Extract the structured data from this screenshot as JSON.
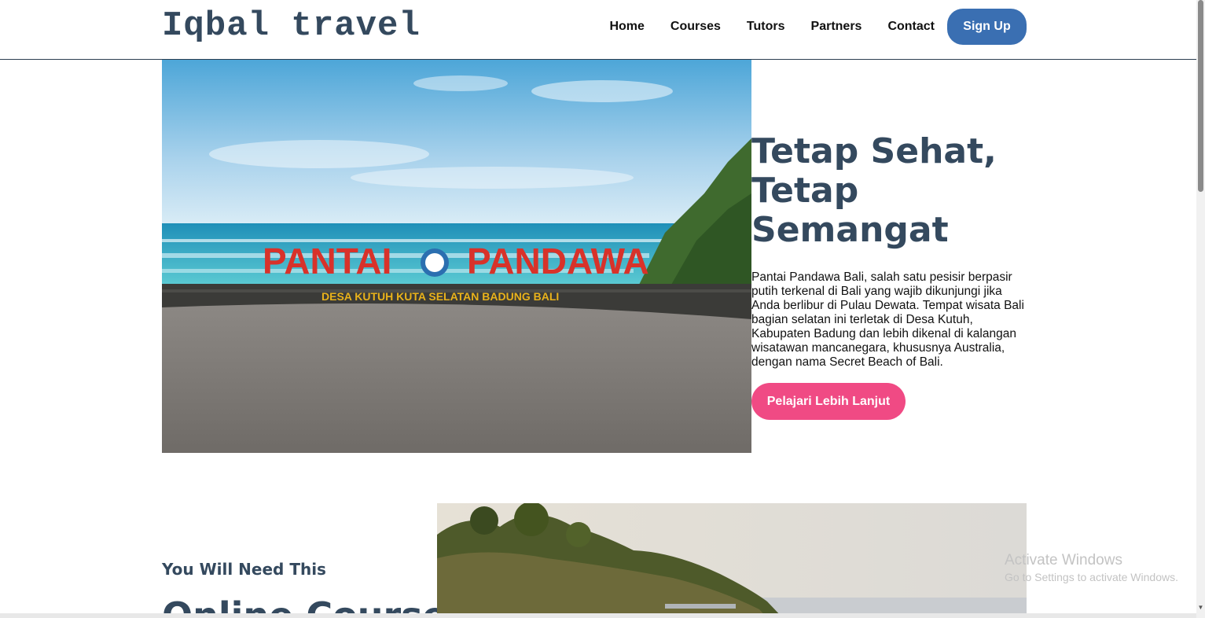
{
  "brand": {
    "name": "Iqbal travel"
  },
  "nav": {
    "items": [
      {
        "label": "Home"
      },
      {
        "label": "Courses"
      },
      {
        "label": "Tutors"
      },
      {
        "label": "Partners"
      },
      {
        "label": "Contact"
      }
    ],
    "signup_label": "Sign Up"
  },
  "hero": {
    "title": "Tetap Sehat, Tetap Semangat",
    "description": "Pantai Pandawa Bali, salah satu pesisir berpasir putih terkenal di Bali yang wajib dikunjungi jika Anda berlibur di Pulau Dewata. Tempat wisata Bali bagian selatan ini terletak di Desa Kutuh, Kabupaten Badung dan lebih dikenal di kalangan wisatawan mancanegara, khususnya Australia, dengan nama Secret Beach of Bali.",
    "cta_label": "Pelajari Lebih Lanjut",
    "sign": {
      "main_left": "PANTAI",
      "main_right": "PANDAWA",
      "sub": "DESA  KUTUH  KUTA  SELATAN  BADUNG  BALI"
    }
  },
  "section": {
    "subtitle": "You Will Need This",
    "title": "Online Courses"
  },
  "watermark": {
    "title": "Activate Windows",
    "subtitle": "Go to Settings to activate Windows."
  },
  "colors": {
    "brand_text": "#34495e",
    "signup_button": "#3a6fb2",
    "cta_button": "#f04a84",
    "sign_letters": "#d8322a",
    "sign_sub": "#e9b21b"
  }
}
